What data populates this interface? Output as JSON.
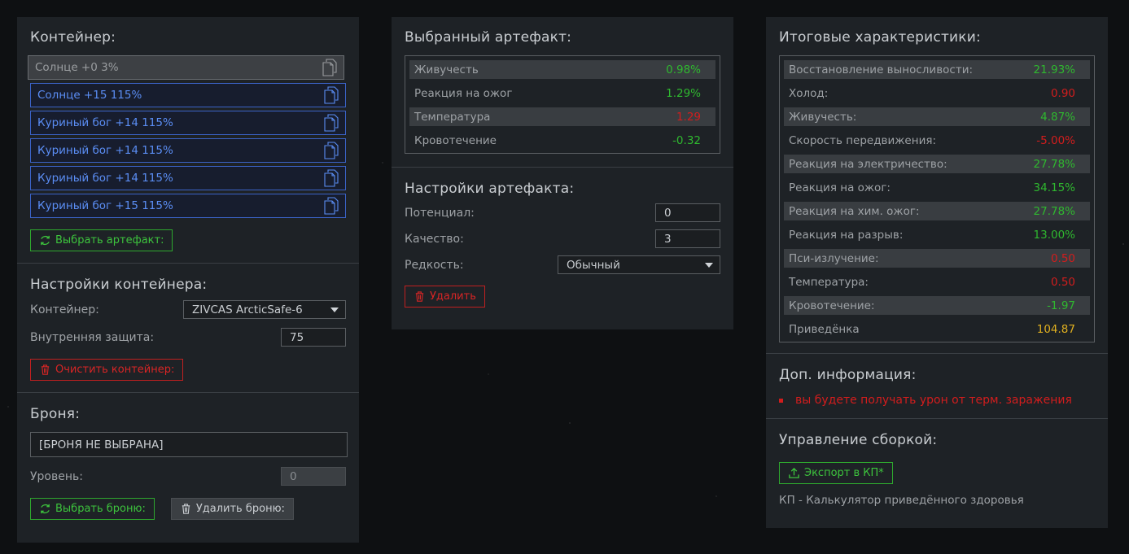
{
  "left": {
    "container_title": "Контейнер:",
    "slots": [
      {
        "text": "Солнце +0 3%",
        "state": "empty"
      },
      {
        "text": "Солнце +15 115%",
        "state": "filled"
      },
      {
        "text": "Куриный бог +14 115%",
        "state": "filled"
      },
      {
        "text": "Куриный бог +14 115%",
        "state": "filled"
      },
      {
        "text": "Куриный бог +14 115%",
        "state": "filled"
      },
      {
        "text": "Куриный бог +15 115%",
        "state": "filled"
      }
    ],
    "select_artifact_btn": "Выбрать артефакт:",
    "container_settings_title": "Настройки контейнера:",
    "container_label": "Контейнер:",
    "container_value": "ZIVCAS ArcticSafe-6",
    "inner_protection_label": "Внутренняя защита:",
    "inner_protection_value": "75",
    "clear_container_btn": "Очистить контейнер:",
    "armor_title": "Броня:",
    "armor_value": "[БРОНЯ НЕ ВЫБРАНА]",
    "level_label": "Уровень:",
    "level_value": "0",
    "select_armor_btn": "Выбрать броню:",
    "delete_armor_btn": "Удалить броню:"
  },
  "middle": {
    "selected_title": "Выбранный артефакт:",
    "stats": [
      {
        "label": "Живучесть",
        "value": "0.98%",
        "color": "green",
        "shaded": true
      },
      {
        "label": "Реакция на ожог",
        "value": "1.29%",
        "color": "green",
        "shaded": false
      },
      {
        "label": "Температура",
        "value": "1.29",
        "color": "red",
        "shaded": true
      },
      {
        "label": "Кровотечение",
        "value": "-0.32",
        "color": "green",
        "shaded": false
      }
    ],
    "settings_title": "Настройки артефакта:",
    "potential_label": "Потенциал:",
    "potential_value": "0",
    "quality_label": "Качество:",
    "quality_value": "3",
    "rarity_label": "Редкость:",
    "rarity_value": "Обычный",
    "delete_btn": "Удалить"
  },
  "right": {
    "totals_title": "Итоговые характеристики:",
    "stats": [
      {
        "label": "Восстановление выносливости:",
        "value": "21.93%",
        "color": "green",
        "shaded": true
      },
      {
        "label": "Холод:",
        "value": "0.90",
        "color": "red",
        "shaded": false
      },
      {
        "label": "Живучесть:",
        "value": "4.87%",
        "color": "green",
        "shaded": true
      },
      {
        "label": "Скорость передвижения:",
        "value": "-5.00%",
        "color": "red",
        "shaded": false
      },
      {
        "label": "Реакция на электричество:",
        "value": "27.78%",
        "color": "green",
        "shaded": true
      },
      {
        "label": "Реакция на ожог:",
        "value": "34.15%",
        "color": "green",
        "shaded": false
      },
      {
        "label": "Реакция на хим. ожог:",
        "value": "27.78%",
        "color": "green",
        "shaded": true
      },
      {
        "label": "Реакция на разрыв:",
        "value": "13.00%",
        "color": "green",
        "shaded": false
      },
      {
        "label": "Пси-излучение:",
        "value": "0.50",
        "color": "red",
        "shaded": true
      },
      {
        "label": "Температура:",
        "value": "0.50",
        "color": "red",
        "shaded": false
      },
      {
        "label": "Кровотечение:",
        "value": "-1.97",
        "color": "green",
        "shaded": true
      },
      {
        "label": "Приведёнка",
        "value": "104.87",
        "color": "gold",
        "shaded": false
      }
    ],
    "info_title": "Доп. информация:",
    "info_items": [
      "вы будете получать урон от терм. заражения"
    ],
    "build_title": "Управление сборкой:",
    "export_btn": "Экспорт в КП*",
    "footnote": "КП - Калькулятор приведённого здоровья"
  },
  "colors": {
    "green": "#2fb82f",
    "red": "#d21d1d",
    "gold": "#e0b020",
    "blue": "#5b8ef5"
  }
}
